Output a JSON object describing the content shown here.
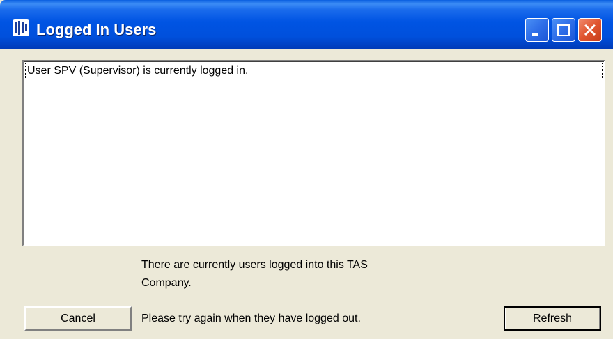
{
  "window": {
    "title": "Logged In Users",
    "icon": "app-logo-icon"
  },
  "controls": {
    "minimize_icon": "minimize-icon",
    "maximize_icon": "maximize-icon",
    "close_icon": "close-icon"
  },
  "list": {
    "items": [
      {
        "text": "User SPV (Supervisor) is currently logged in."
      }
    ]
  },
  "messages": {
    "line1": "There are currently users logged into this TAS",
    "line2": "Company.",
    "line3": "Please try again when they have logged out."
  },
  "buttons": {
    "cancel": "Cancel",
    "refresh": "Refresh"
  },
  "colors": {
    "titlebar": "#0054e3",
    "close": "#e0552f",
    "dialog_bg": "#ece9d8"
  }
}
